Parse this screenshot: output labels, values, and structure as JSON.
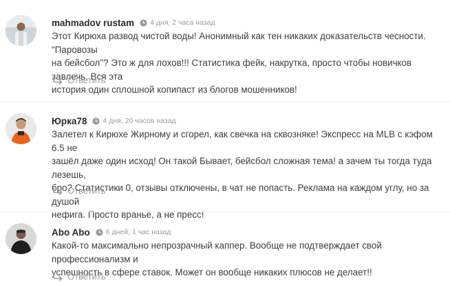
{
  "comments": [
    {
      "author": "mahmadov rustam",
      "time": "4 дня, 2 часа назад",
      "lines": [
        "Этот Кирюха развод чистой воды! Анонимный как тен никаких доказательств чесности. \"Паровозы",
        "на бейсбол\"? Это ж для лохов!!! Статистика фейк, накрутка, просто чтобы новичков завлечь. Вся эта",
        "история один сплошной копипаст из блогов мошенников!"
      ],
      "reply_label": "Ответить"
    },
    {
      "author": "Юрка78",
      "time": "4 дня, 20 часов назад",
      "lines": [
        "Залетел к Кирюхе Жирному и сгорел, как свечка на сквозняке! Экспресс на MLB с кэфом 6.5 не",
        "зашёл даже один исход! Он такой Бывает, бейсбол сложная тема! а зачем ты тогда туда лезешь,",
        "бро? Статистики 0, отзывы отключены, в чат не попасть. Реклама на каждом углу, но за душой",
        "нефига. Просто враньё, а не пресс!"
      ],
      "reply_label": "Ответить"
    },
    {
      "author": "Abo Abo",
      "time": "6 дней, 1 час назад",
      "lines": [
        "Какой-то максимально непрозрачный каппер. Вообще не подтверждает свой профессионализм и",
        "успешность в сфере ставок. Может он вообще никаких плюсов не делает!!"
      ],
      "reply_label": "Ответить"
    }
  ],
  "colors": {
    "author": "#2b2b2b",
    "text": "#3d3d3d",
    "muted": "#9a9a9a",
    "separator": "#efefef"
  },
  "icons": {
    "time": "clock-icon",
    "reply": "reply-arrow-icon"
  }
}
